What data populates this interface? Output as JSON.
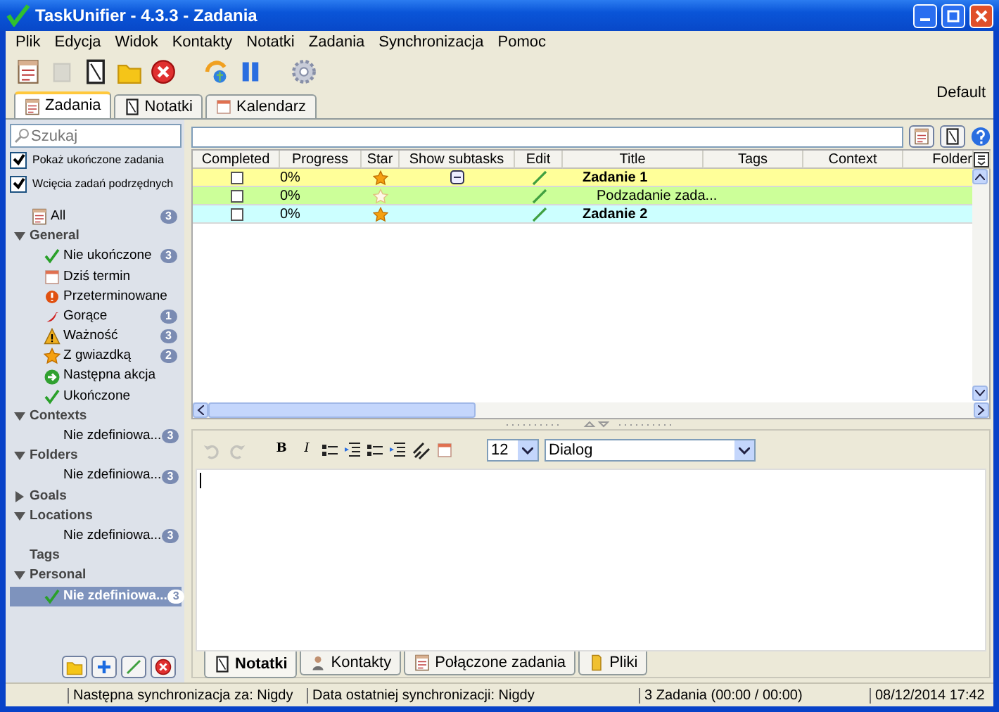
{
  "window": {
    "title": "TaskUnifier - 4.3.3 - Zadania"
  },
  "menu": [
    "Plik",
    "Edycja",
    "Widok",
    "Kontakty",
    "Notatki",
    "Zadania",
    "Synchronizacja",
    "Pomoc"
  ],
  "toolbar": [
    {
      "kind": "task",
      "disabled": false
    },
    {
      "kind": "copy",
      "disabled": true
    },
    {
      "kind": "note",
      "disabled": false
    },
    {
      "kind": "folder",
      "disabled": false
    },
    {
      "kind": "delete",
      "disabled": false
    },
    {
      "kind": "sync",
      "disabled": false
    },
    {
      "kind": "pause",
      "disabled": false
    },
    {
      "kind": "settings",
      "disabled": false
    }
  ],
  "profile": "Default",
  "main_tabs": [
    {
      "label": "Zadania",
      "kind": "task",
      "selected": true
    },
    {
      "label": "Notatki",
      "kind": "note",
      "selected": false
    },
    {
      "label": "Kalendarz",
      "kind": "calendar",
      "selected": false
    }
  ],
  "sidebar": {
    "search": {
      "placeholder": "Szukaj"
    },
    "options": [
      {
        "label": "Pokaż ukończone zadania",
        "checked": true
      },
      {
        "label": "Wcięcia zadań podrzędnych",
        "checked": true
      }
    ],
    "tree": [
      {
        "label": "All",
        "kind": "task",
        "count": "3",
        "selected": false
      },
      {
        "label": "General",
        "kind": "group",
        "expanded": true,
        "selected": false,
        "children": [
          {
            "label": "Nie ukończone",
            "kind": "check",
            "count": "3",
            "selected": false
          },
          {
            "label": "Dziś termin",
            "kind": "calendar",
            "selected": false
          },
          {
            "label": "Przeterminowane",
            "kind": "alert",
            "selected": false
          },
          {
            "label": "Gorące",
            "kind": "pepper",
            "count": "1",
            "selected": false
          },
          {
            "label": "Ważność",
            "kind": "warning",
            "count": "3",
            "selected": false
          },
          {
            "label": "Z gwiazdką",
            "kind": "star",
            "count": "2",
            "selected": false
          },
          {
            "label": "Następna akcja",
            "kind": "next",
            "selected": false
          },
          {
            "label": "Ukończone",
            "kind": "check",
            "selected": false
          }
        ]
      },
      {
        "label": "Contexts",
        "kind": "group",
        "expanded": true,
        "selected": false,
        "children": [
          {
            "label": "Nie zdefiniowa...",
            "kind": "plain",
            "count": "3",
            "selected": false
          }
        ]
      },
      {
        "label": "Folders",
        "kind": "group",
        "expanded": true,
        "selected": false,
        "children": [
          {
            "label": "Nie zdefiniowa...",
            "kind": "plain",
            "count": "3",
            "selected": false
          }
        ]
      },
      {
        "label": "Goals",
        "kind": "group",
        "expanded": false,
        "selected": false
      },
      {
        "label": "Locations",
        "kind": "group",
        "expanded": true,
        "selected": false,
        "children": [
          {
            "label": "Nie zdefiniowa...",
            "kind": "plain",
            "count": "3",
            "selected": false
          }
        ]
      },
      {
        "label": "Tags",
        "kind": "group",
        "selected": false
      },
      {
        "label": "Personal",
        "kind": "group",
        "expanded": true,
        "selected": false,
        "children": [
          {
            "label": "Nie zdefiniowa...",
            "kind": "check",
            "count": "3",
            "selected": true
          }
        ]
      }
    ],
    "buttons": [
      {
        "kind": "folder"
      },
      {
        "kind": "add"
      },
      {
        "kind": "edit"
      },
      {
        "kind": "delete"
      }
    ]
  },
  "table": {
    "columns": [
      "Completed",
      "Progress",
      "Star",
      "Show subtasks",
      "Edit",
      "Title",
      "Tags",
      "Context",
      "Folder"
    ],
    "rows": [
      {
        "completed": false,
        "progress": "0%",
        "starred": true,
        "title": "Zadanie 1",
        "color": "#ffff99",
        "expanded": true,
        "children": [
          {
            "completed": false,
            "progress": "0%",
            "starred": false,
            "title": "Podzadanie zada...",
            "color": "#ccff99"
          }
        ]
      },
      {
        "completed": false,
        "progress": "0%",
        "starred": true,
        "title": "Zadanie 2",
        "color": "#ccffff"
      }
    ]
  },
  "editor": {
    "history": [
      {
        "kind": "undo",
        "disabled": true
      },
      {
        "kind": "redo",
        "disabled": true
      }
    ],
    "bold": "B",
    "italic": "I",
    "font_size": "12",
    "font": "Dialog"
  },
  "bottom_tabs": [
    {
      "label": "Notatki",
      "kind": "note",
      "selected": true
    },
    {
      "label": "Kontakty",
      "kind": "person",
      "selected": false
    },
    {
      "label": "Połączone zadania",
      "kind": "task",
      "selected": false
    },
    {
      "label": "Pliki",
      "kind": "file",
      "selected": false
    }
  ],
  "status_bar": [
    "Następna synchronizacja za: Nigdy",
    "Data ostatniej synchronizacji: Nigdy",
    "3 Zadania (00:00 / 00:00)",
    "08/12/2014 17:42"
  ]
}
